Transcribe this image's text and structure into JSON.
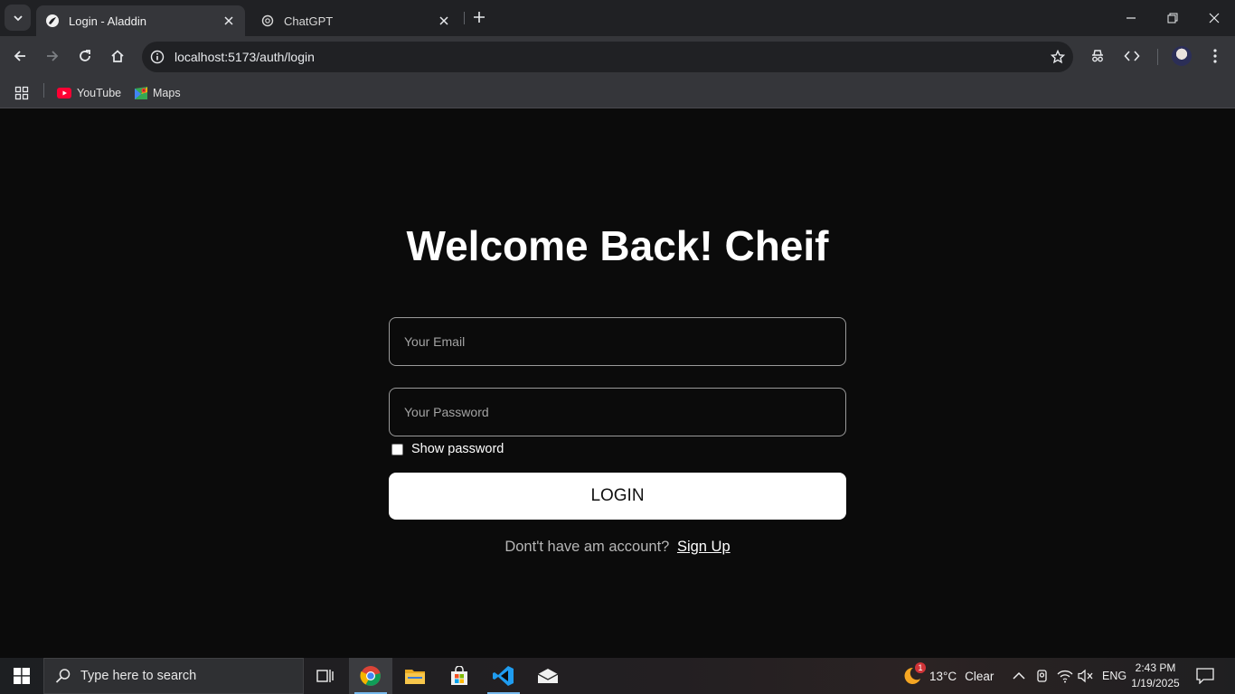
{
  "browser": {
    "tabs": [
      {
        "title": "Login - Aladdin",
        "active": true
      },
      {
        "title": "ChatGPT",
        "active": false
      }
    ],
    "url": "localhost:5173/auth/login",
    "bookmarks": [
      {
        "label": "YouTube"
      },
      {
        "label": "Maps"
      }
    ]
  },
  "page": {
    "heading": "Welcome Back! Cheif",
    "email_placeholder": "Your Email",
    "password_placeholder": "Your Password",
    "show_password_label": "Show password",
    "login_button": "LOGIN",
    "signup_prompt": "Dont't have am account?",
    "signup_link": "Sign Up"
  },
  "taskbar": {
    "search_placeholder": "Type here to search",
    "weather_temp": "13°C",
    "weather_text": "Clear",
    "weather_badge": "1",
    "language": "ENG",
    "time": "2:43 PM",
    "date": "1/19/2025"
  },
  "colors": {
    "page_bg": "#0b0b0b",
    "button_bg": "#ffffff",
    "chrome_tab_bg": "#202124",
    "chrome_toolbar_bg": "#35363a"
  }
}
